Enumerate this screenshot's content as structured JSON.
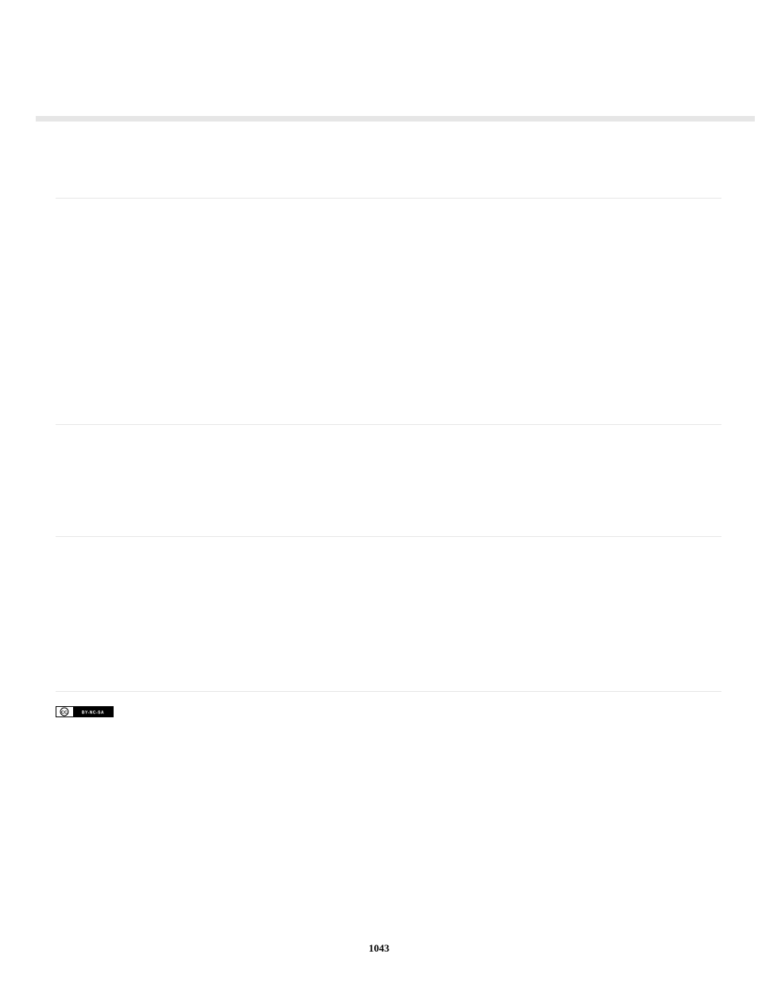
{
  "page_number": "1043",
  "cc_badge": {
    "left_text": "CC",
    "right_text": "BY-NC-SA"
  }
}
